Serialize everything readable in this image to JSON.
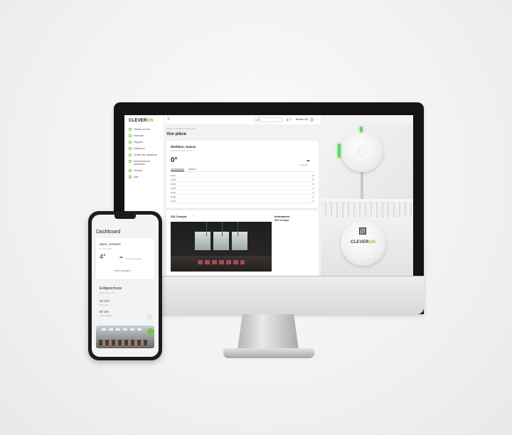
{
  "app": {
    "logo_main": "CLEVER",
    "logo_accent": "ON",
    "brand_color": "#7cc242"
  },
  "sidebar": {
    "items": [
      {
        "label": "Tableau de bord",
        "icon": "dashboard-icon"
      },
      {
        "label": "Immeuble",
        "icon": "building-icon"
      },
      {
        "label": "Rapports",
        "icon": "report-icon"
      },
      {
        "label": "Utilisateurs",
        "icon": "users-icon"
      },
      {
        "label": "Gestion des utilisateurs",
        "icon": "user-management-icon"
      },
      {
        "label": "Abonnements et paramètres",
        "icon": "subscription-icon"
      },
      {
        "label": "Services",
        "icon": "services-icon"
      },
      {
        "label": "Aide",
        "icon": "help-icon"
      }
    ]
  },
  "topbar": {
    "unit": "CH",
    "notifications": "2",
    "user": "Bureau ZID"
  },
  "main": {
    "breadcrumb": "Suisse > Dietlikon > Vue pièce",
    "title": "Vue pièce",
    "weather": {
      "city": "Dietlikon, Suisse",
      "date": "11 janvier 2023, 12:10",
      "temp": "0°",
      "condition": "Nuageux",
      "tabs": [
        "AUJOURD'HUI",
        "DEMAIN"
      ],
      "forecast": [
        {
          "time": "11:00",
          "temp": "0°"
        },
        {
          "time": "12:00",
          "temp": "0°"
        },
        {
          "time": "13:00",
          "temp": "0°"
        },
        {
          "time": "14:00",
          "temp": "-1°"
        },
        {
          "time": "15:00",
          "temp": "-1°"
        },
        {
          "time": "16:00",
          "temp": "-1°"
        },
        {
          "time": "17:00",
          "temp": "-1°"
        }
      ]
    },
    "cockpit": {
      "title": "ZID Cockpit",
      "indicators_title": "Indicateurs",
      "indicators_sub": "ZID Cockpit"
    }
  },
  "device": {
    "brand_main": "CLEVER",
    "brand_accent": "ON"
  },
  "phone": {
    "title": "Dashboard",
    "weather": {
      "city": "Spiez, Schweiz",
      "date": "Mi, 11.01.2023",
      "temp": "4°",
      "condition": "Teilweise bewölkt",
      "more": "Mehr anzeigen"
    },
    "floor": {
      "title": "Erdgeschoss",
      "subtitle": "Total Räume: 12",
      "temp_value": "17.3°C",
      "temp_label": "Temperatur",
      "hum_value": "67.1%",
      "hum_label": "Luftfeuchtigkeit"
    }
  }
}
